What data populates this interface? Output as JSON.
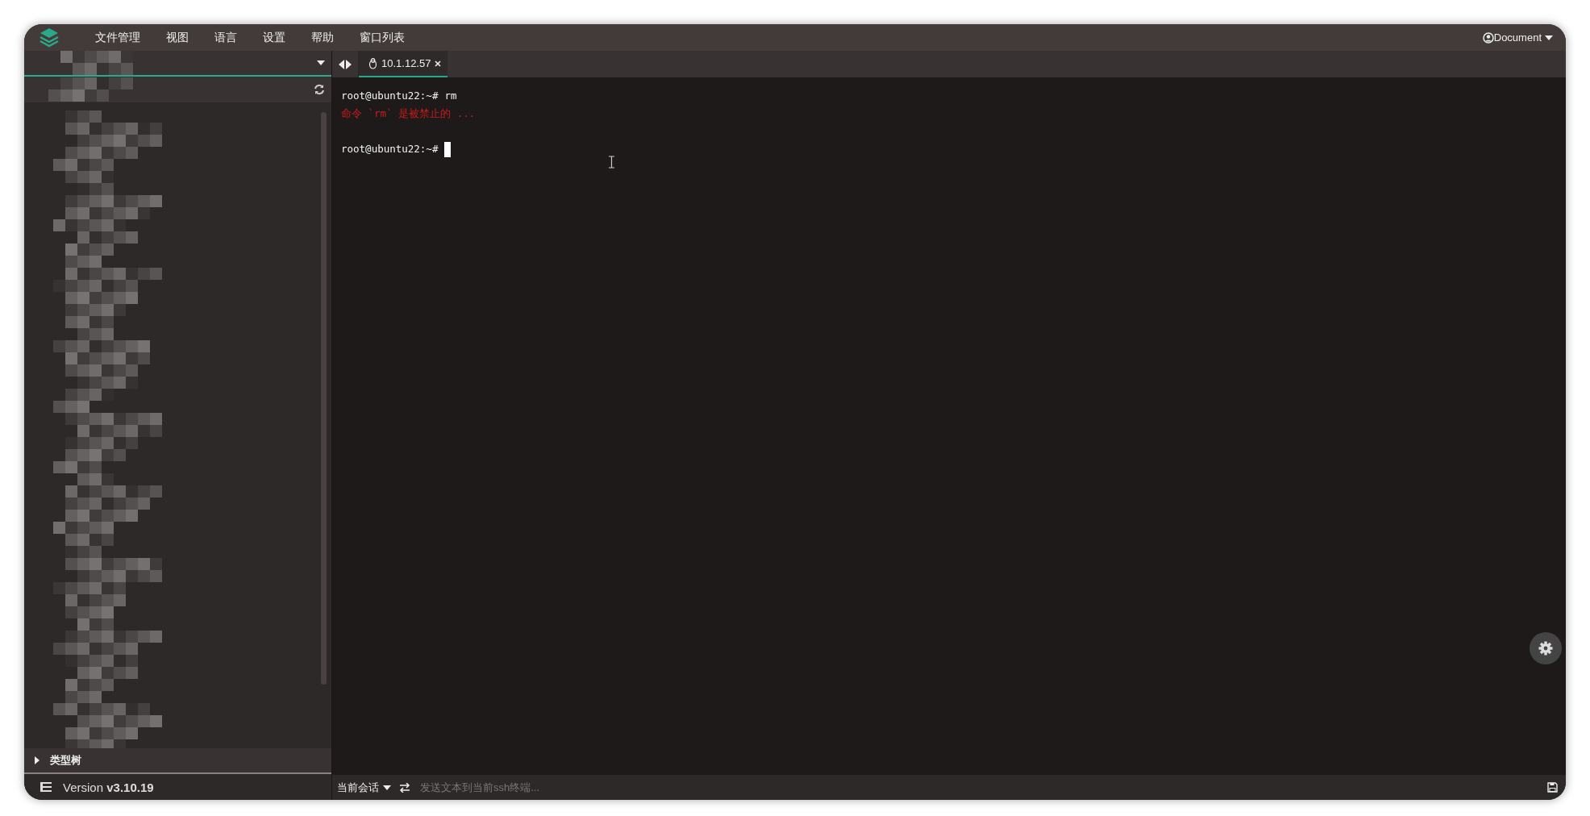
{
  "menu": {
    "items": [
      "文件管理",
      "视图",
      "语言",
      "设置",
      "帮助",
      "窗口列表"
    ]
  },
  "user": {
    "label": "Document"
  },
  "tabs": [
    {
      "label": "10.1.12.57",
      "selected": true
    }
  ],
  "terminal": {
    "lines": [
      {
        "kind": "prompt",
        "prompt": "root@ubuntu22:~#",
        "command": "rm",
        "cursor": false
      },
      {
        "kind": "error",
        "text": "命令 `rm` 是被禁止的 ..."
      },
      {
        "kind": "blank"
      },
      {
        "kind": "prompt",
        "prompt": "root@ubuntu22:~#",
        "cursor": true
      }
    ]
  },
  "sidebar": {
    "section": {
      "label": "类型树",
      "expanded": false
    },
    "version": "Version **v3.10.19**"
  },
  "input_bar": {
    "session": "当前会话",
    "placeholder": "发送文本到当前ssh终端..."
  }
}
